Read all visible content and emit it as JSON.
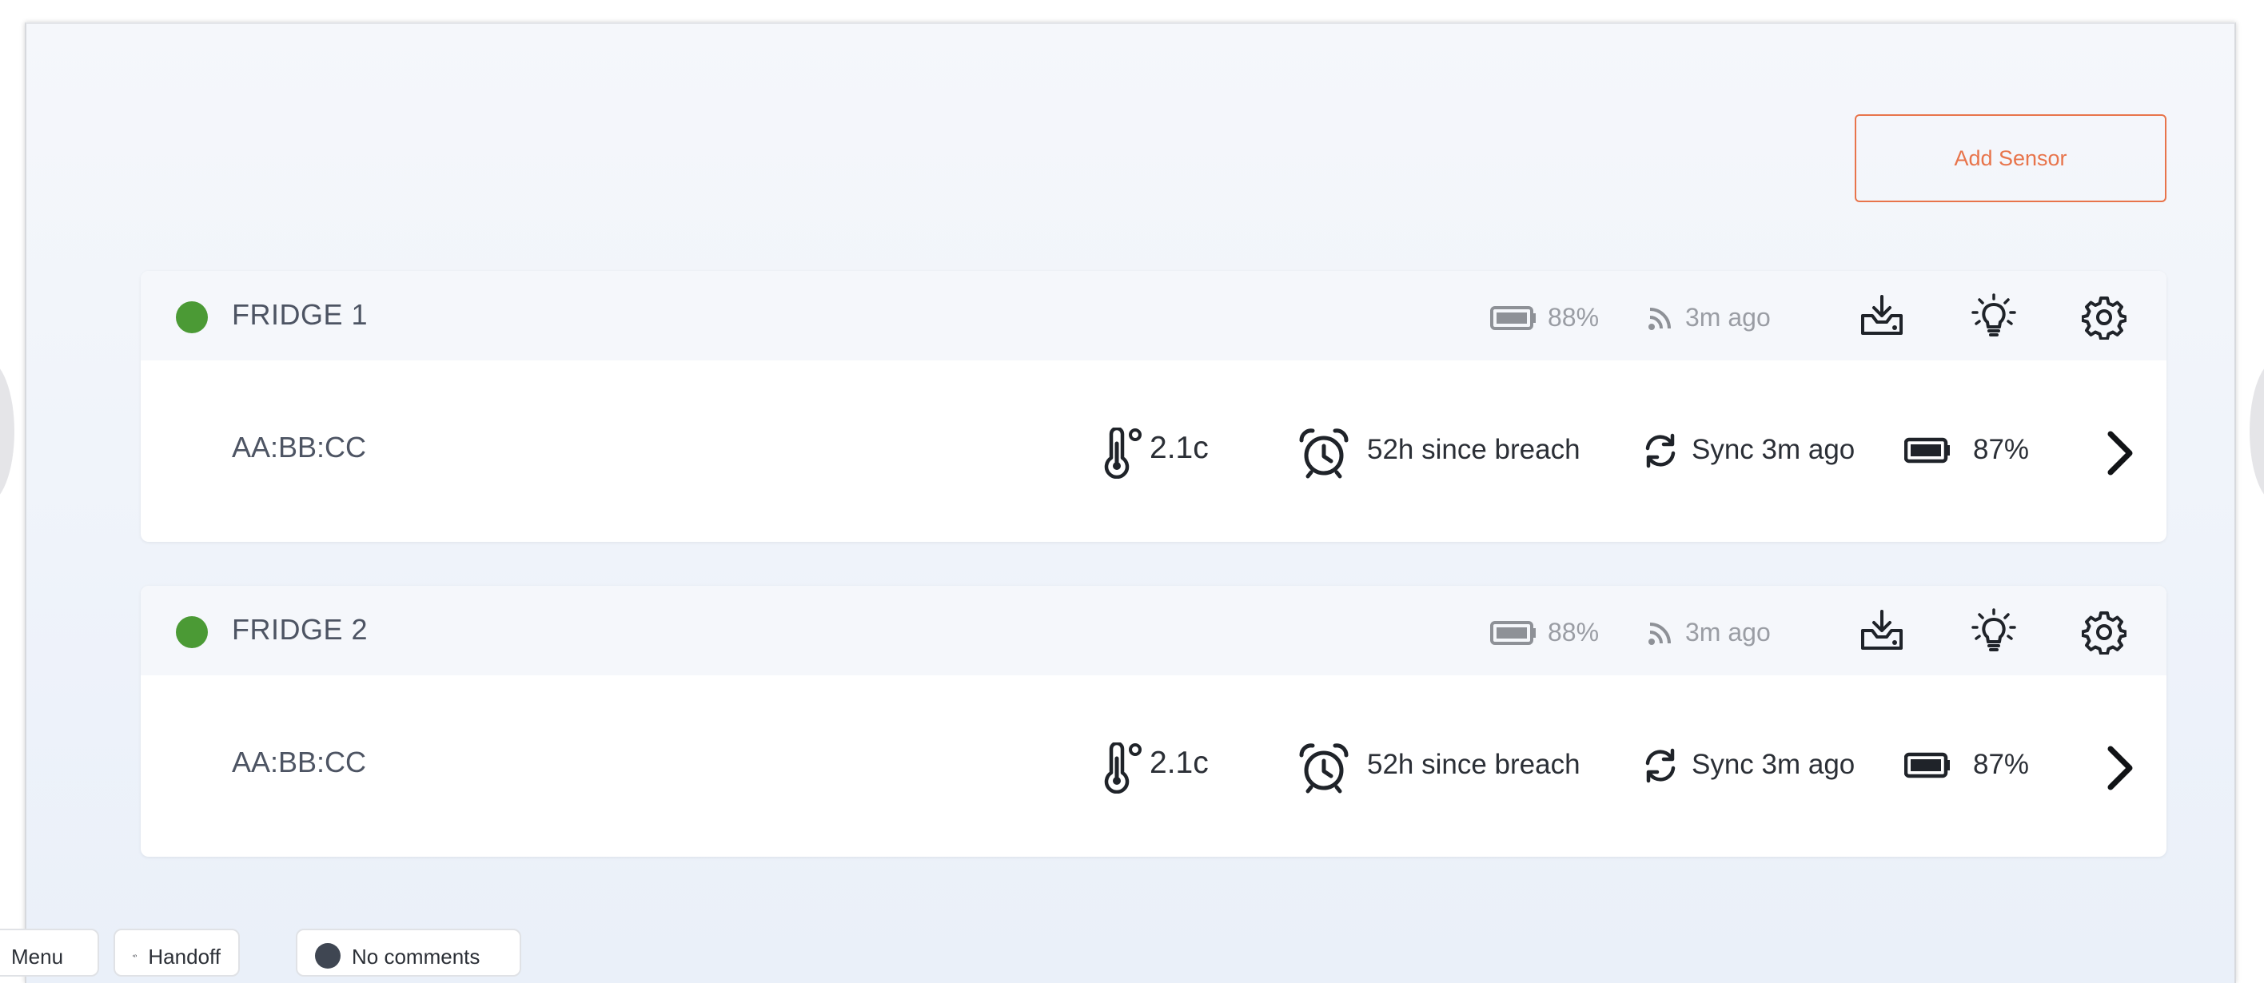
{
  "toolbar": {
    "add_sensor_label": "Add Sensor"
  },
  "sensors": [
    {
      "name": "FRIDGE 1",
      "status_color": "#4b9a35",
      "header_battery": "88%",
      "header_signal": "3m ago",
      "mac": "AA:BB:CC",
      "temperature": "2.1c",
      "breach": "52h since breach",
      "sync": "Sync 3m ago",
      "battery": "87%"
    },
    {
      "name": "FRIDGE 2",
      "status_color": "#4b9a35",
      "header_battery": "88%",
      "header_signal": "3m ago",
      "mac": "AA:BB:CC",
      "temperature": "2.1c",
      "breach": "52h since breach",
      "sync": "Sync 3m ago",
      "battery": "87%"
    }
  ],
  "bottom_tabs": {
    "menu": "Menu",
    "handoff": "Handoff",
    "comments": "No comments"
  },
  "colors": {
    "accent": "#e8744b",
    "status_ok": "#4b9a35",
    "muted_text": "#9a9da4"
  },
  "icons": [
    "battery-icon",
    "signal-icon",
    "download-icon",
    "bulb-icon",
    "gear-icon",
    "thermometer-icon",
    "alarm-clock-icon",
    "sync-icon",
    "chevron-right-icon",
    "code-icon"
  ]
}
